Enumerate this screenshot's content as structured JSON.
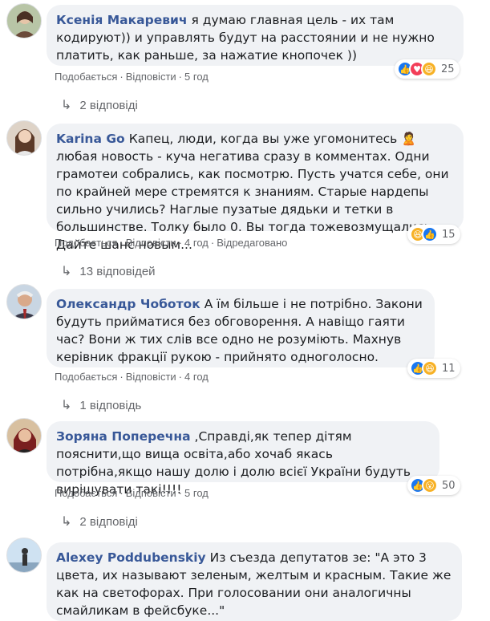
{
  "comments": [
    {
      "author": "Ксенія Макаревич",
      "text": "я думаю главная цель - их там кодируют)) и управлять будут на расстоянии и не нужно платить, как раньше, за нажатие кнопочек ))",
      "like": "Подобається",
      "reply": "Відповісти",
      "time": "5 год",
      "edited": "",
      "reaction_count": "25",
      "replies": "2 відповіді"
    },
    {
      "author": "Karina Go",
      "text": "Капец, люди, когда вы уже угомонитесь 🙎 любая новость - куча негатива сразу в комментах. Одни грамотеи собрались, как посмотрю. Пусть учатся себе, они по крайней мере стремятся к знаниям. Старые нардепы сильно учились? Наглые пузатые дядьки и тетки в большинстве. Толку было 0. Вы тогда тожевозмущались. Дайте шанс новым...",
      "like": "Подобається",
      "reply": "Відповісти",
      "time": "4 год",
      "edited": "Відредаговано",
      "reaction_count": "15",
      "replies": "13 відповідей"
    },
    {
      "author": "Олександр Чоботок",
      "text": "А їм більше і не потрібно. Закони будуть прийматися без обговорення. А навіщо гаяти час? Вони ж тих слів все одно не розуміють. Махнув керівник фракції рукою - прийнято одноголосно.",
      "like": "Подобається",
      "reply": "Відповісти",
      "time": "4 год",
      "edited": "",
      "reaction_count": "11",
      "replies": "1 відповідь"
    },
    {
      "author": "Зоряна Поперечна",
      "text": ",Справді,як тепер дітям пояснити,що вища освіта,або хочаб якась потрібна,якщо нашу долю і долю всієї України будуть вирішувати такі!!!!",
      "like": "Подобається",
      "reply": "Відповісти",
      "time": "5 год",
      "edited": "",
      "reaction_count": "50",
      "replies": "2 відповіді"
    },
    {
      "author": "Alexey Poddubenskiy",
      "text": "Из съезда депутатов зе: \"А это 3 цвета, их называют зеленым, желтым и красным. Такие же как на светофорах. При голосовании они аналогичны смайликам в фейсбуке...\"",
      "like": "",
      "reply": "",
      "time": "",
      "edited": "",
      "reaction_count": "",
      "replies": ""
    }
  ],
  "colors": {
    "author": "#385898",
    "bubble": "#f0f2f5",
    "meta": "#65676b",
    "like": "#1877f2",
    "love": "#f33e58",
    "haha": "#f7b125"
  }
}
